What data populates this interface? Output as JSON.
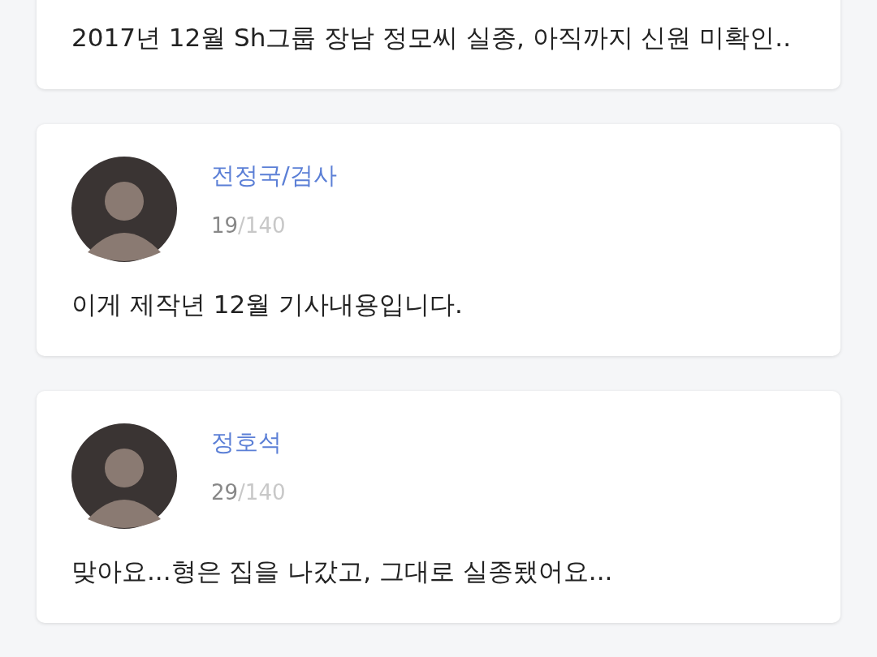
{
  "posts": [
    {
      "kind": "note",
      "text": "2017년 12월 Sh그룹 장남 정모씨 실종, 아직까지 신원 미확인.."
    },
    {
      "kind": "comment",
      "author": "전정국/검사",
      "count": "19",
      "limit": "/140",
      "text": "이게 제작년 12월 기사내용입니다."
    },
    {
      "kind": "comment",
      "author": "정호석",
      "count": "29",
      "limit": "/140",
      "text": "맞아요...형은 집을 나갔고, 그대로 실종됐어요..."
    }
  ]
}
